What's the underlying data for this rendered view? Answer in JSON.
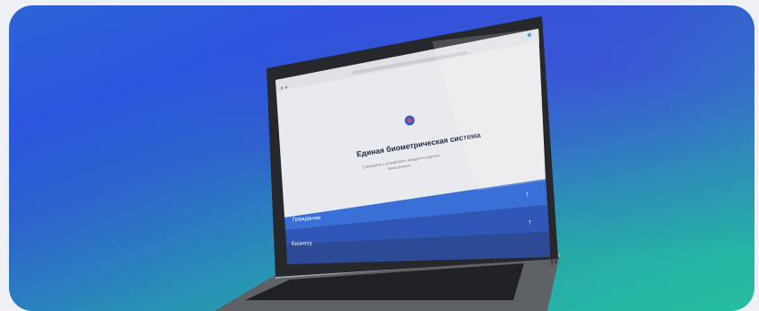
{
  "screen": {
    "title": "Единая биометрическая система",
    "subtitle_line1": "Собирайте и отправляйте, ожидайте в данных",
    "subtitle_line2": "базах данных",
    "bar_top_label": "",
    "bar_mid_label": "Гражданам",
    "bar_bottom_label": "Бизнесу"
  },
  "colors": {
    "bg_top": "#2f63d8",
    "bg_bottom": "#25bfa0",
    "bar_top": "#3a6fd7",
    "bar_mid": "#2f57b8",
    "bar_bottom": "#2c4a95"
  }
}
